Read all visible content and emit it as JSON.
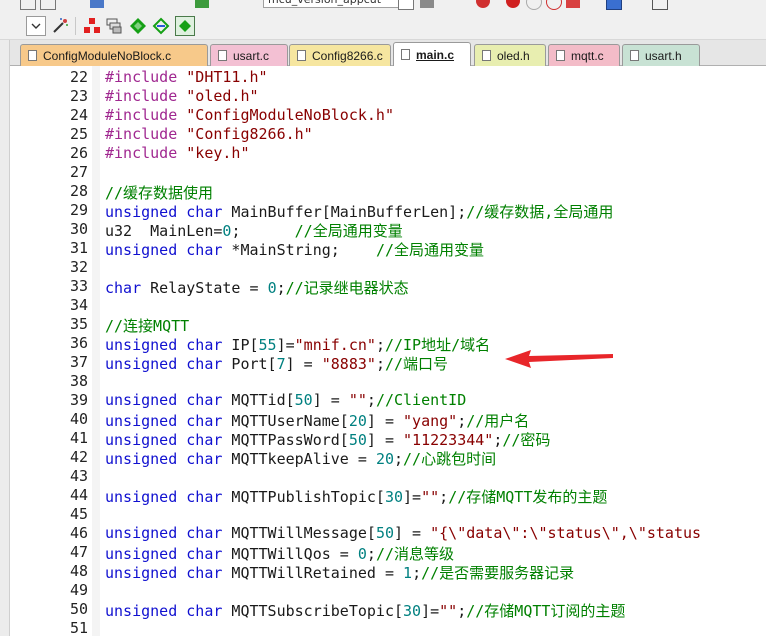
{
  "toolbar": {
    "target_combo_value": "mcu_version_appcut",
    "colors": {
      "red": "#e22020",
      "green": "#15a015",
      "blue": "#2a5bd7"
    }
  },
  "tabs": [
    {
      "label": "ConfigModuleNoBlock.c",
      "color": "#f7c98a",
      "active": false
    },
    {
      "label": "usart.c",
      "color": "#f3c0d3",
      "active": false
    },
    {
      "label": "Config8266.c",
      "color": "#f6e6a0",
      "active": false
    },
    {
      "label": "main.c",
      "color": "#ffffff",
      "active": true
    },
    {
      "label": "oled.h",
      "color": "#e8eeb0",
      "active": false
    },
    {
      "label": "mqtt.c",
      "color": "#f3bcc8",
      "active": false
    },
    {
      "label": "usart.h",
      "color": "#c8e2d4",
      "active": false
    }
  ],
  "editor": {
    "lines": [
      {
        "n": "22",
        "tokens": [
          {
            "t": "#include ",
            "c": "pp"
          },
          {
            "t": "\"DHT11.h\"",
            "c": "str"
          }
        ]
      },
      {
        "n": "23",
        "tokens": [
          {
            "t": "#include ",
            "c": "pp"
          },
          {
            "t": "\"oled.h\"",
            "c": "str"
          }
        ]
      },
      {
        "n": "24",
        "tokens": [
          {
            "t": "#include ",
            "c": "pp"
          },
          {
            "t": "\"ConfigModuleNoBlock.h\"",
            "c": "str"
          }
        ]
      },
      {
        "n": "25",
        "tokens": [
          {
            "t": "#include ",
            "c": "pp"
          },
          {
            "t": "\"Config8266.h\"",
            "c": "str"
          }
        ]
      },
      {
        "n": "26",
        "tokens": [
          {
            "t": "#include ",
            "c": "pp"
          },
          {
            "t": "\"key.h\"",
            "c": "str"
          }
        ]
      },
      {
        "n": "27",
        "tokens": []
      },
      {
        "n": "28",
        "tokens": [
          {
            "t": "//缓存数据使用",
            "c": "cm"
          }
        ]
      },
      {
        "n": "29",
        "tokens": [
          {
            "t": "unsigned char",
            "c": "kw"
          },
          {
            "t": " MainBuffer[MainBufferLen];",
            "c": ""
          },
          {
            "t": "//缓存数据,全局通用",
            "c": "cm"
          }
        ]
      },
      {
        "n": "30",
        "tokens": [
          {
            "t": "u32  MainLen=",
            "c": ""
          },
          {
            "t": "0",
            "c": "num"
          },
          {
            "t": ";      ",
            "c": ""
          },
          {
            "t": "//全局通用变量",
            "c": "cm"
          }
        ]
      },
      {
        "n": "31",
        "tokens": [
          {
            "t": "unsigned char",
            "c": "kw"
          },
          {
            "t": " *MainString;    ",
            "c": ""
          },
          {
            "t": "//全局通用变量",
            "c": "cm"
          }
        ]
      },
      {
        "n": "32",
        "tokens": []
      },
      {
        "n": "33",
        "tokens": [
          {
            "t": "char",
            "c": "kw"
          },
          {
            "t": " RelayState = ",
            "c": ""
          },
          {
            "t": "0",
            "c": "num"
          },
          {
            "t": ";",
            "c": ""
          },
          {
            "t": "//记录继电器状态",
            "c": "cm"
          }
        ]
      },
      {
        "n": "34",
        "tokens": []
      },
      {
        "n": "35",
        "tokens": [
          {
            "t": "//连接MQTT",
            "c": "cm"
          }
        ]
      },
      {
        "n": "36",
        "tokens": [
          {
            "t": "unsigned char",
            "c": "kw"
          },
          {
            "t": " IP[",
            "c": ""
          },
          {
            "t": "55",
            "c": "num"
          },
          {
            "t": "]=",
            "c": ""
          },
          {
            "t": "\"mnif.cn\"",
            "c": "str"
          },
          {
            "t": ";",
            "c": ""
          },
          {
            "t": "//IP地址/域名",
            "c": "cm"
          }
        ]
      },
      {
        "n": "37",
        "tokens": [
          {
            "t": "unsigned char",
            "c": "kw"
          },
          {
            "t": " Port[",
            "c": ""
          },
          {
            "t": "7",
            "c": "num"
          },
          {
            "t": "] = ",
            "c": ""
          },
          {
            "t": "\"8883\"",
            "c": "str"
          },
          {
            "t": ";",
            "c": ""
          },
          {
            "t": "//端口号",
            "c": "cm"
          }
        ]
      },
      {
        "n": "38",
        "tokens": []
      },
      {
        "n": "39",
        "tokens": [
          {
            "t": "unsigned char",
            "c": "kw"
          },
          {
            "t": " MQTTid[",
            "c": ""
          },
          {
            "t": "50",
            "c": "num"
          },
          {
            "t": "] = ",
            "c": ""
          },
          {
            "t": "\"\"",
            "c": "str"
          },
          {
            "t": ";",
            "c": ""
          },
          {
            "t": "//ClientID",
            "c": "cm"
          }
        ]
      },
      {
        "n": "40",
        "tokens": [
          {
            "t": "unsigned char",
            "c": "kw"
          },
          {
            "t": " MQTTUserName[",
            "c": ""
          },
          {
            "t": "20",
            "c": "num"
          },
          {
            "t": "] = ",
            "c": ""
          },
          {
            "t": "\"yang\"",
            "c": "str"
          },
          {
            "t": ";",
            "c": ""
          },
          {
            "t": "//用户名",
            "c": "cm"
          }
        ]
      },
      {
        "n": "41",
        "tokens": [
          {
            "t": "unsigned char",
            "c": "kw"
          },
          {
            "t": " MQTTPassWord[",
            "c": ""
          },
          {
            "t": "50",
            "c": "num"
          },
          {
            "t": "] = ",
            "c": ""
          },
          {
            "t": "\"11223344\"",
            "c": "str"
          },
          {
            "t": ";",
            "c": ""
          },
          {
            "t": "//密码",
            "c": "cm"
          }
        ]
      },
      {
        "n": "42",
        "tokens": [
          {
            "t": "unsigned char",
            "c": "kw"
          },
          {
            "t": " MQTTkeepAlive = ",
            "c": ""
          },
          {
            "t": "20",
            "c": "num"
          },
          {
            "t": ";",
            "c": ""
          },
          {
            "t": "//心跳包时间",
            "c": "cm"
          }
        ]
      },
      {
        "n": "43",
        "tokens": []
      },
      {
        "n": "44",
        "tokens": [
          {
            "t": "unsigned char",
            "c": "kw"
          },
          {
            "t": " MQTTPublishTopic[",
            "c": ""
          },
          {
            "t": "30",
            "c": "num"
          },
          {
            "t": "]=",
            "c": ""
          },
          {
            "t": "\"\"",
            "c": "str"
          },
          {
            "t": ";",
            "c": ""
          },
          {
            "t": "//存储MQTT发布的主题",
            "c": "cm"
          }
        ]
      },
      {
        "n": "45",
        "tokens": []
      },
      {
        "n": "46",
        "tokens": [
          {
            "t": "unsigned char",
            "c": "kw"
          },
          {
            "t": " MQTTWillMessage[",
            "c": ""
          },
          {
            "t": "50",
            "c": "num"
          },
          {
            "t": "] = ",
            "c": ""
          },
          {
            "t": "\"{\\\"data\\\":\\\"status\\\",\\\"status",
            "c": "str"
          }
        ]
      },
      {
        "n": "47",
        "tokens": [
          {
            "t": "unsigned char",
            "c": "kw"
          },
          {
            "t": " MQTTWillQos = ",
            "c": ""
          },
          {
            "t": "0",
            "c": "num"
          },
          {
            "t": ";",
            "c": ""
          },
          {
            "t": "//消息等级",
            "c": "cm"
          }
        ]
      },
      {
        "n": "48",
        "tokens": [
          {
            "t": "unsigned char",
            "c": "kw"
          },
          {
            "t": " MQTTWillRetained = ",
            "c": ""
          },
          {
            "t": "1",
            "c": "num"
          },
          {
            "t": ";",
            "c": ""
          },
          {
            "t": "//是否需要服务器记录",
            "c": "cm"
          }
        ]
      },
      {
        "n": "49",
        "tokens": []
      },
      {
        "n": "50",
        "tokens": [
          {
            "t": "unsigned char",
            "c": "kw"
          },
          {
            "t": " MQTTSubscribeTopic[",
            "c": ""
          },
          {
            "t": "30",
            "c": "num"
          },
          {
            "t": "]=",
            "c": ""
          },
          {
            "t": "\"\"",
            "c": "str"
          },
          {
            "t": ";",
            "c": ""
          },
          {
            "t": "//存储MQTT订阅的主题",
            "c": "cm"
          }
        ]
      },
      {
        "n": "51",
        "tokens": []
      }
    ]
  },
  "annotation": {
    "arrow_color": "#e8262a",
    "points_to_line": "37"
  }
}
